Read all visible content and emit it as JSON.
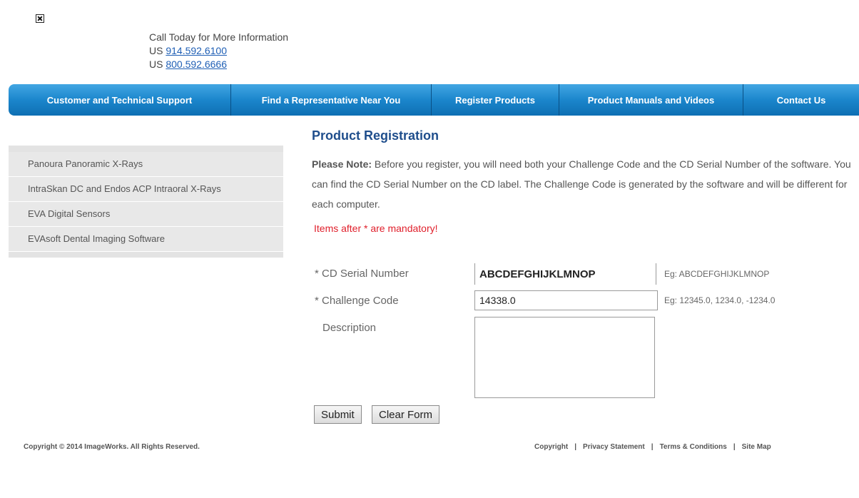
{
  "header": {
    "call_text": "Call Today for More Information",
    "phones": [
      {
        "prefix": "US",
        "number": "914.592.6100"
      },
      {
        "prefix": "US",
        "number": "800.592.6666"
      }
    ]
  },
  "nav": {
    "items": [
      "Customer and Technical Support",
      "Find a Representative Near You",
      "Register Products",
      "Product Manuals and Videos",
      "Contact Us"
    ]
  },
  "sidebar": {
    "items": [
      "Panoura Panoramic X-Rays",
      "IntraSkan DC and Endos ACP Intraoral X-Rays",
      "EVA Digital Sensors",
      "EVAsoft Dental Imaging Software"
    ]
  },
  "main": {
    "title": "Product Registration",
    "note_label": "Please Note:",
    "note_text": " Before you register, you will need both your Challenge Code and the CD Serial Number of the software. You can find the CD Serial Number on the CD label. The Challenge Code is generated by the software and will be different for each computer.",
    "mandatory_text": "Items after * are mandatory!"
  },
  "form": {
    "serial_label": "* CD Serial Number",
    "serial_value": "ABCDEFGHIJKLMNOP",
    "serial_hint": "Eg: ABCDEFGHIJKLMNOP",
    "challenge_label": "* Challenge Code",
    "challenge_value": "14338.0",
    "challenge_hint": "Eg: 12345.0, 1234.0, -1234.0",
    "description_label": "Description",
    "description_value": "",
    "submit_label": "Submit",
    "clear_label": "Clear Form"
  },
  "footer": {
    "copyright": "Copyright © 2014 ImageWorks. All Rights Reserved.",
    "links": [
      "Copyright",
      "Privacy Statement",
      "Terms & Conditions",
      "Site Map"
    ],
    "separator": "|"
  },
  "colors": {
    "nav_gradient_top": "#42a6e3",
    "nav_gradient_bottom": "#0e6fb3",
    "title": "#1f4e8c",
    "mandatory": "#e0202c",
    "link": "#1f5fb5"
  }
}
